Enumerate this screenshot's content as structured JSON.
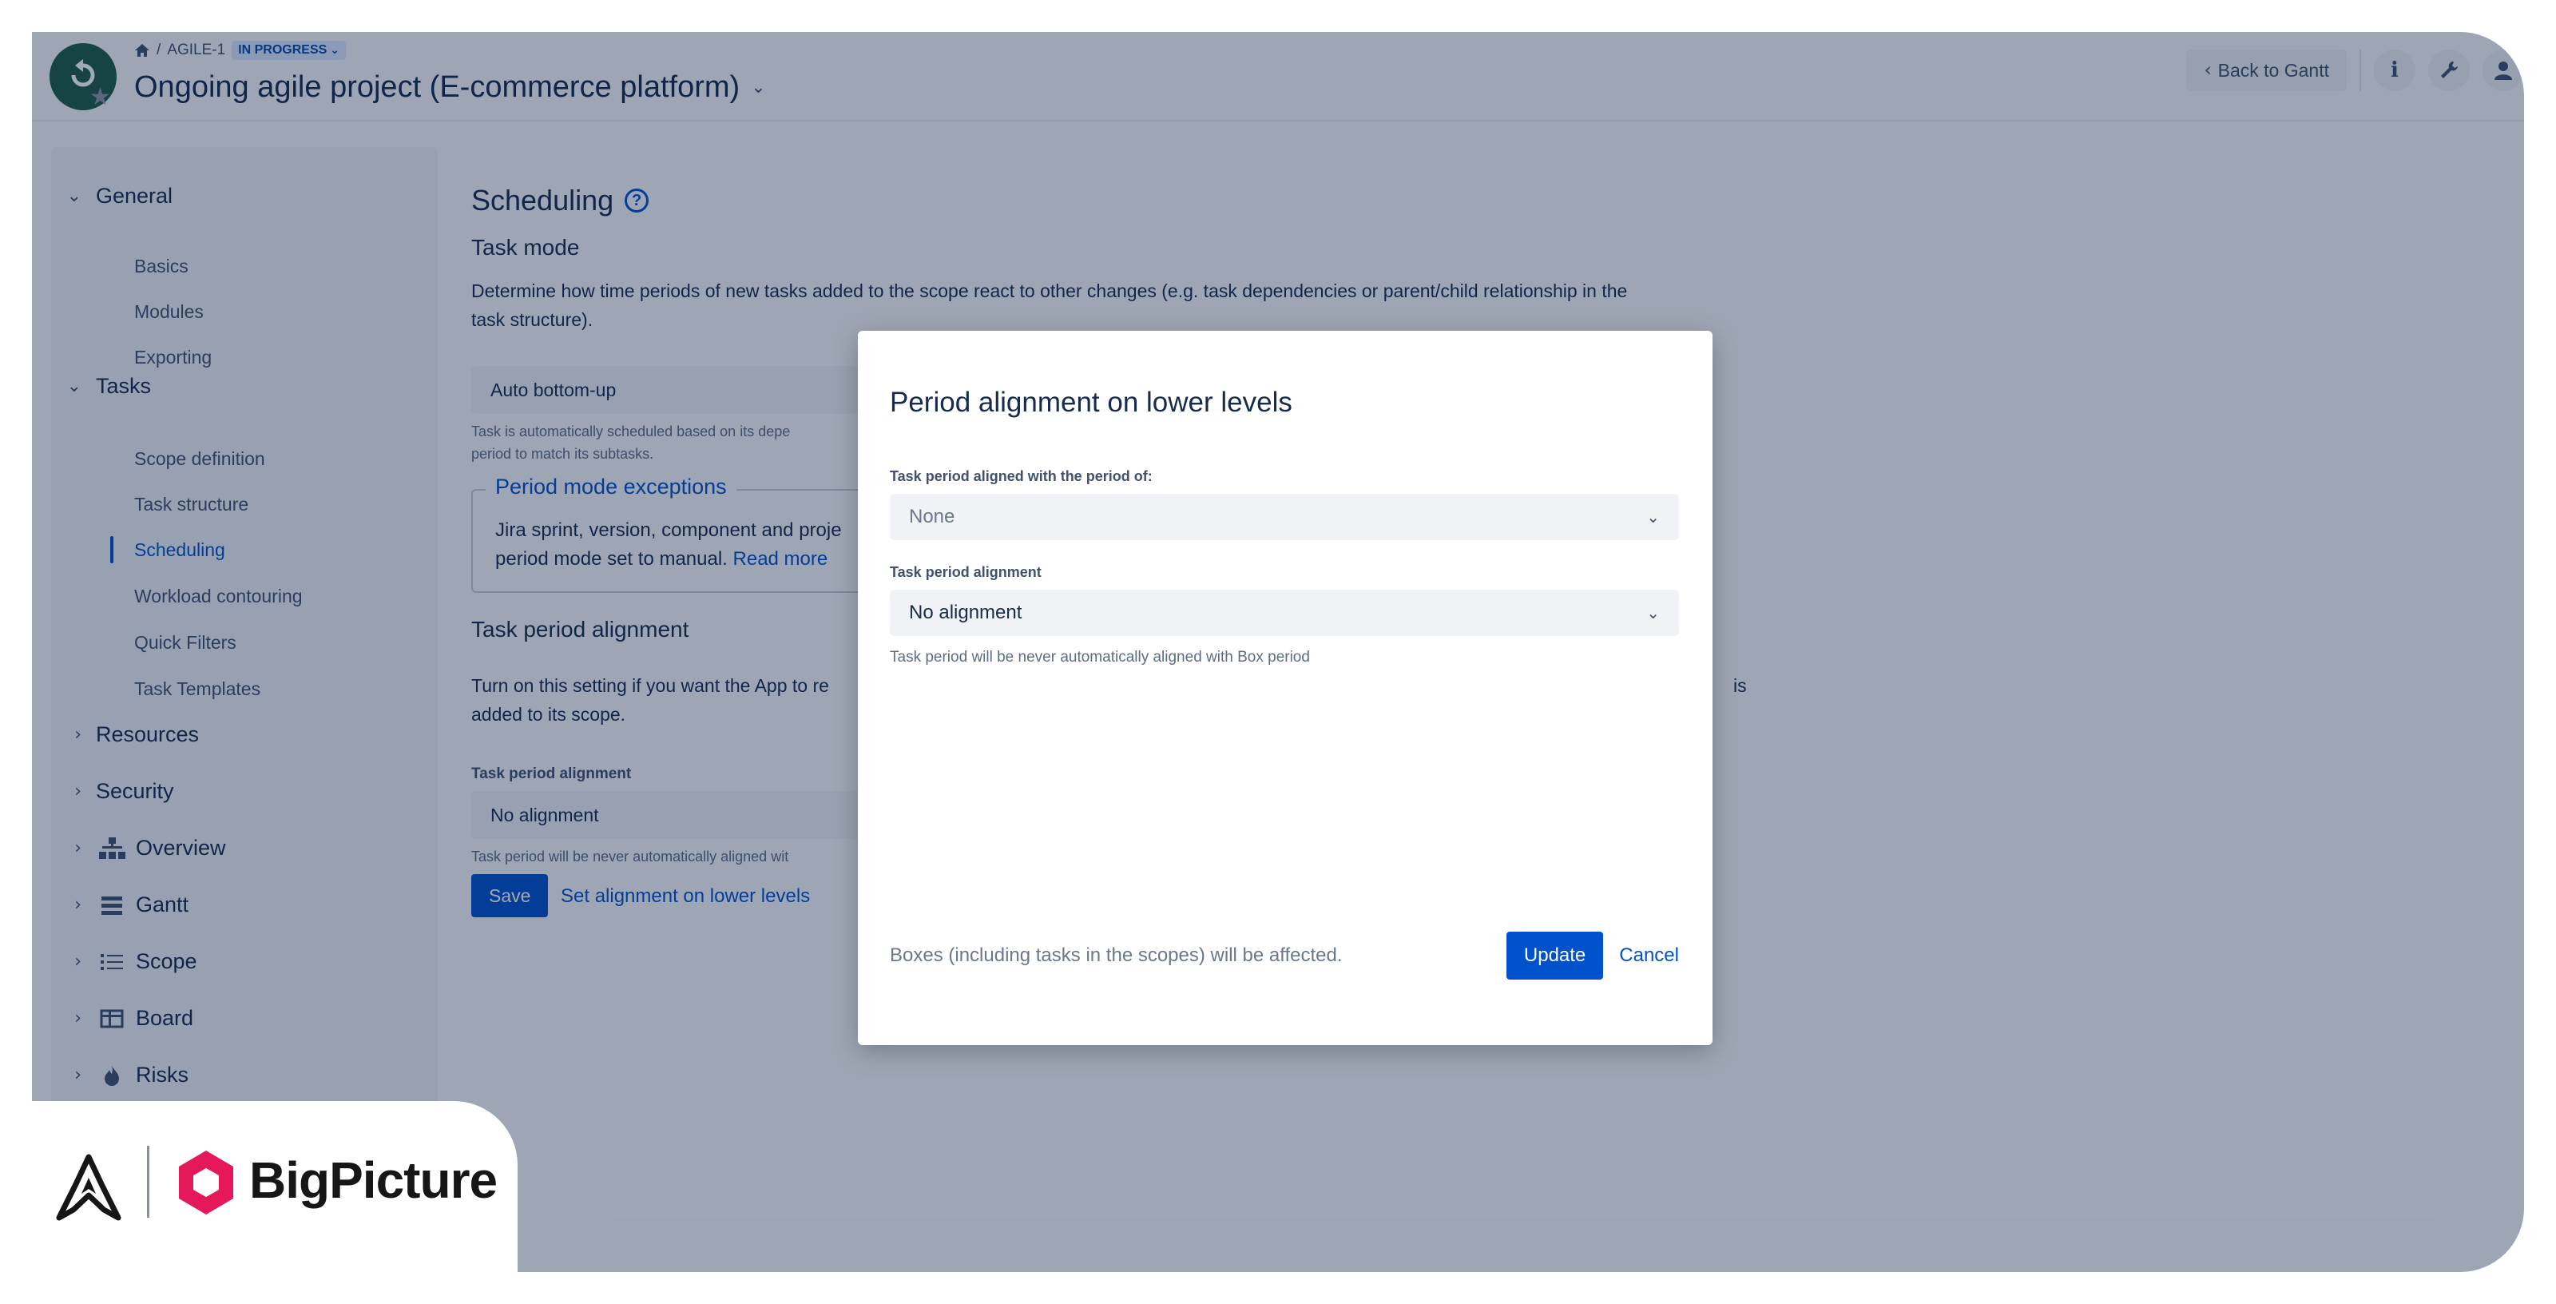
{
  "header": {
    "breadcrumb_home_icon": "home-icon",
    "breadcrumb_sep": "/",
    "issue_key": "AGILE-1",
    "status": "IN PROGRESS",
    "title": "Ongoing agile project (E-commerce platform)",
    "back_label": "Back to Gantt",
    "icons": [
      "info-icon",
      "wrench-icon",
      "user-icon"
    ]
  },
  "sidebar": {
    "groups": [
      {
        "label": "General",
        "expanded": true,
        "items": [
          "Basics",
          "Modules",
          "Exporting"
        ]
      },
      {
        "label": "Tasks",
        "expanded": true,
        "items": [
          "Scope definition",
          "Task structure",
          "Scheduling",
          "Workload contouring",
          "Quick Filters",
          "Task Templates"
        ]
      },
      {
        "label": "Resources",
        "expanded": false
      },
      {
        "label": "Security",
        "expanded": false
      },
      {
        "label": "Overview",
        "expanded": false,
        "icon": "hierarchy-icon"
      },
      {
        "label": "Gantt",
        "expanded": false,
        "icon": "gantt-icon"
      },
      {
        "label": "Scope",
        "expanded": false,
        "icon": "list-icon"
      },
      {
        "label": "Board",
        "expanded": false,
        "icon": "board-icon"
      },
      {
        "label": "Risks",
        "expanded": false,
        "icon": "fire-icon"
      }
    ],
    "active_item": "Scheduling"
  },
  "main": {
    "title": "Scheduling",
    "task_mode_title": "Task mode",
    "task_mode_desc_1": "Determine how time periods of new tasks added to the scope react to other changes (e.g. task dependencies or parent/child relationship in the",
    "task_mode_desc_2": "task structure).",
    "task_mode_value": "Auto bottom-up",
    "task_mode_help_1": "Task is automatically scheduled based on its depe",
    "task_mode_help_2": "period to match its subtasks.",
    "exceptions_title": "Period mode exceptions",
    "exceptions_text_1": "Jira sprint, version, component and proje",
    "exceptions_text_2": "period mode set to manual.",
    "read_more": "Read more",
    "alignment_title": "Task period alignment",
    "alignment_desc_1": "Turn on this setting if you want the App to re",
    "alignment_desc_1_tail": "is",
    "alignment_desc_2": "added to its scope.",
    "alignment_label": "Task period alignment",
    "alignment_value": "No alignment",
    "alignment_help": "Task period will be never automatically aligned wit",
    "save_label": "Save",
    "set_lower_label": "Set alignment on lower levels"
  },
  "modal": {
    "title": "Period alignment on lower levels",
    "aligned_with_label": "Task period aligned with the period of:",
    "aligned_with_value": "None",
    "alignment_label": "Task period alignment",
    "alignment_value": "No alignment",
    "alignment_help": "Task period will be never automatically aligned with Box period",
    "affected_text": "Boxes (including tasks in the scopes) will be affected.",
    "update_label": "Update",
    "cancel_label": "Cancel"
  },
  "brand": {
    "name": "BigPicture",
    "accent": "#e5195a"
  }
}
